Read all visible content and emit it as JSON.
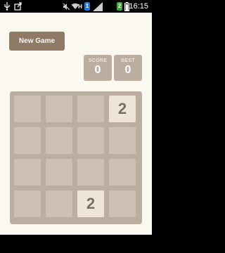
{
  "status_bar": {
    "time": "16:15",
    "icons": [
      "usb-icon",
      "upload-icon",
      "mute-icon",
      "wifi-icon",
      "network-type-h",
      "sim-1-badge",
      "signal-icon",
      "sim-2-badge",
      "battery-icon"
    ],
    "network_type": "H",
    "sim1": "1",
    "sim2": "2",
    "colors": {
      "sim1": "#1a7ad9",
      "sim2": "#39a839"
    }
  },
  "header": {
    "new_game_label": "New Game"
  },
  "score": {
    "label": "SCORE",
    "value": "0"
  },
  "best": {
    "label": "BEST",
    "value": "0"
  },
  "board": {
    "size": 4,
    "grid": [
      [
        null,
        null,
        null,
        2
      ],
      [
        null,
        null,
        null,
        null
      ],
      [
        null,
        null,
        null,
        null
      ],
      [
        null,
        null,
        2,
        null
      ]
    ],
    "tile_colors": {
      "2": {
        "background": "#eee4da",
        "text": "#776e65"
      }
    },
    "colors": {
      "board": "#bbada0",
      "empty_cell": "#cdc1b4",
      "page": "#fbf8ef",
      "button": "#8f7a66"
    }
  }
}
